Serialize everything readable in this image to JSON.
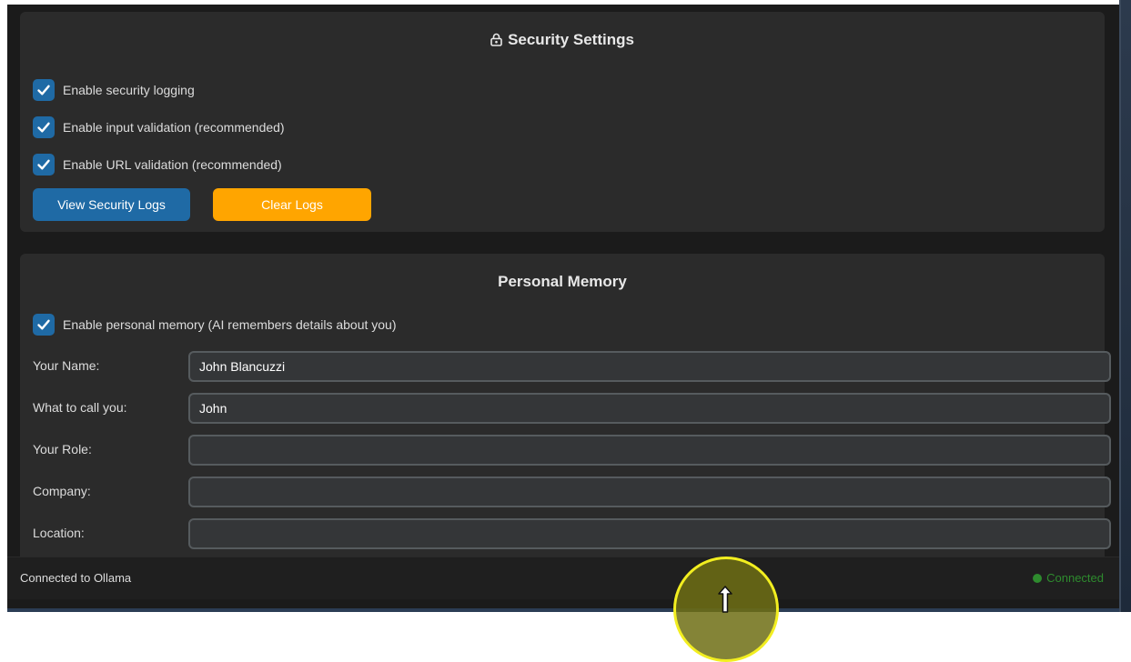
{
  "security": {
    "title": "Security Settings",
    "icon": "lock-icon",
    "options": [
      {
        "label": "Enable security logging",
        "checked": true
      },
      {
        "label": "Enable input validation (recommended)",
        "checked": true
      },
      {
        "label": "Enable URL validation (recommended)",
        "checked": true
      }
    ],
    "view_logs_label": "View Security Logs",
    "clear_logs_label": "Clear Logs"
  },
  "memory": {
    "title": "Personal Memory",
    "enable_label": "Enable personal memory (AI remembers details about you)",
    "enable_checked": true,
    "fields": [
      {
        "label": "Your Name:",
        "value": "John Blancuzzi"
      },
      {
        "label": "What to call you:",
        "value": "John"
      },
      {
        "label": "Your Role:",
        "value": ""
      },
      {
        "label": "Company:",
        "value": ""
      },
      {
        "label": "Location:",
        "value": ""
      }
    ]
  },
  "status": {
    "left_text": "Connected to Ollama",
    "right_text": "Connected",
    "right_color": "#2e8b2e"
  },
  "colors": {
    "accent_blue": "#1f6aa5",
    "accent_orange": "#ffa500",
    "panel_bg": "#2b2b2b",
    "window_bg": "#1b1b1b"
  }
}
